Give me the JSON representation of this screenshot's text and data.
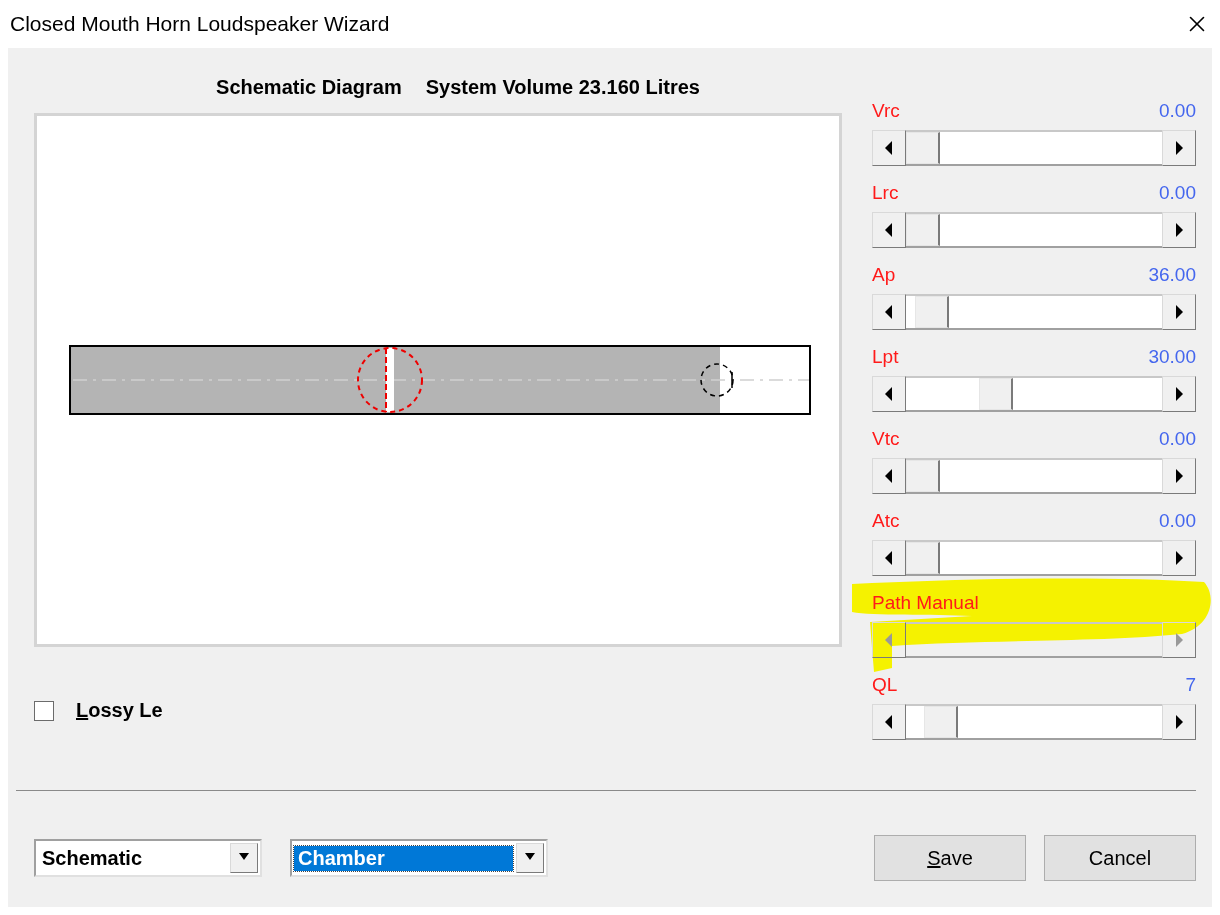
{
  "window": {
    "title": "Closed Mouth Horn Loudspeaker Wizard"
  },
  "diagram": {
    "heading": "Schematic Diagram",
    "volume": "System Volume 23.160 Litres"
  },
  "sliders": [
    {
      "label": "Vrc",
      "reading": "0.00",
      "disabled": false,
      "highlighted": false
    },
    {
      "label": "Lrc",
      "reading": "0.00",
      "disabled": false,
      "highlighted": false
    },
    {
      "label": "Ap",
      "reading": "36.00",
      "disabled": false,
      "highlighted": false
    },
    {
      "label": "Lpt",
      "reading": "30.00",
      "disabled": false,
      "highlighted": false
    },
    {
      "label": "Vtc",
      "reading": "0.00",
      "disabled": false,
      "highlighted": false
    },
    {
      "label": "Atc",
      "reading": "0.00",
      "disabled": false,
      "highlighted": false
    },
    {
      "label": "Path Manual",
      "disabled": true,
      "highlighted": true
    },
    {
      "label": "QL",
      "reading": "7",
      "disabled": false,
      "highlighted": false
    }
  ],
  "lossy": {
    "label": "Lossy Le",
    "checked": false,
    "underline_first": true
  },
  "selects": [
    {
      "value": "Schematic",
      "focused": false
    },
    {
      "value": "Chamber",
      "focused": true
    }
  ],
  "buttons": [
    {
      "label": "Save",
      "underline_first": true
    },
    {
      "label": "Cancel",
      "underline_first": false
    }
  ]
}
